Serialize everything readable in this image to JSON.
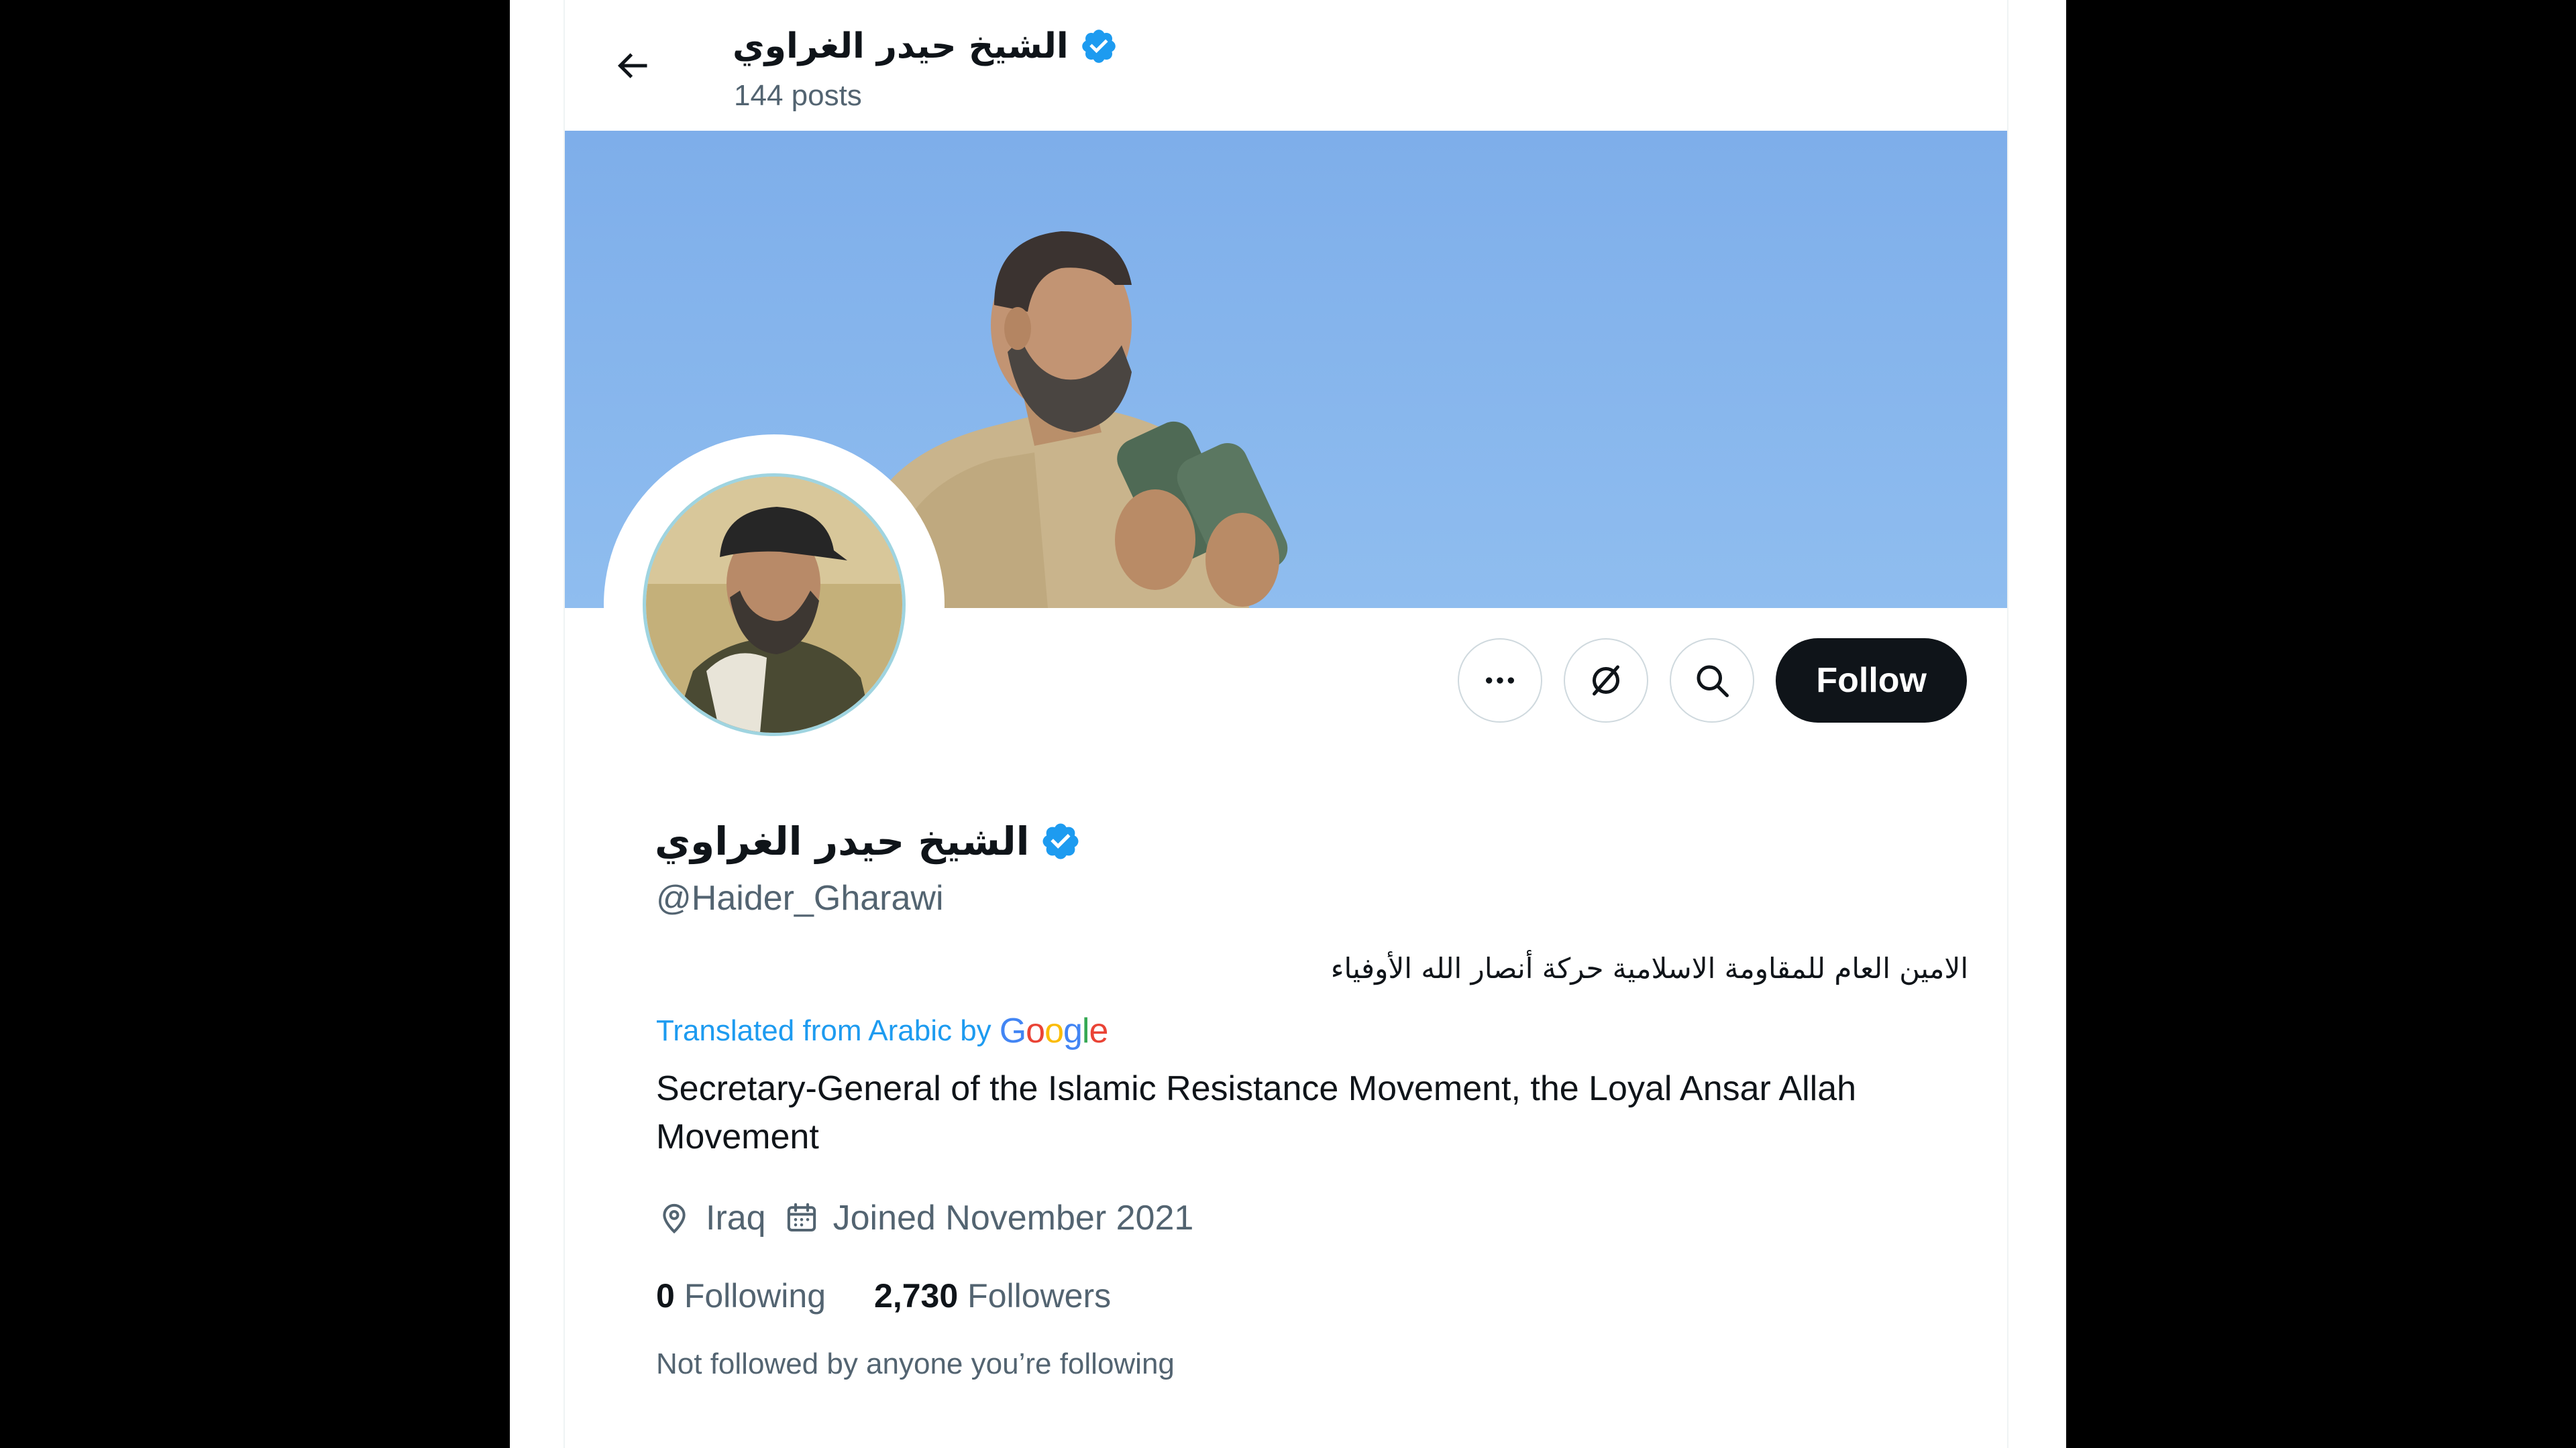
{
  "header": {
    "back_icon": "arrow-left-icon",
    "name": "الشيخ حيدر الغراوي",
    "posts": "144 posts"
  },
  "banner": {
    "description_icon": "banner-photo"
  },
  "actions": {
    "more_icon": "more-horizontal-icon",
    "subscribe_icon": "grok-slash-icon",
    "search_icon": "search-icon",
    "follow_label": "Follow"
  },
  "profile": {
    "name": "الشيخ حيدر الغراوي",
    "handle": "@Haider_Gharawi",
    "bio_arabic": "الامين العام للمقاومة الاسلامية حركة أنصار الله الأوفياء",
    "translated_label": "Translated from Arabic by",
    "google_letters": [
      "G",
      "o",
      "o",
      "g",
      "l",
      "e"
    ],
    "bio_english": "Secretary-General of the Islamic Resistance Movement, the Loyal Ansar Allah Movement",
    "location": "Iraq",
    "joined": "Joined November 2021",
    "following_count": "0",
    "following_label": "Following",
    "followers_count": "2,730",
    "followers_label": "Followers",
    "not_followed": "Not followed by anyone you’re following"
  },
  "colors": {
    "accent": "#1d9bf0",
    "text": "#0f1419",
    "muted": "#536471",
    "google_blue": "#4285f4",
    "google_red": "#ea4335",
    "google_yellow": "#fbbc05",
    "google_green": "#34a853"
  }
}
